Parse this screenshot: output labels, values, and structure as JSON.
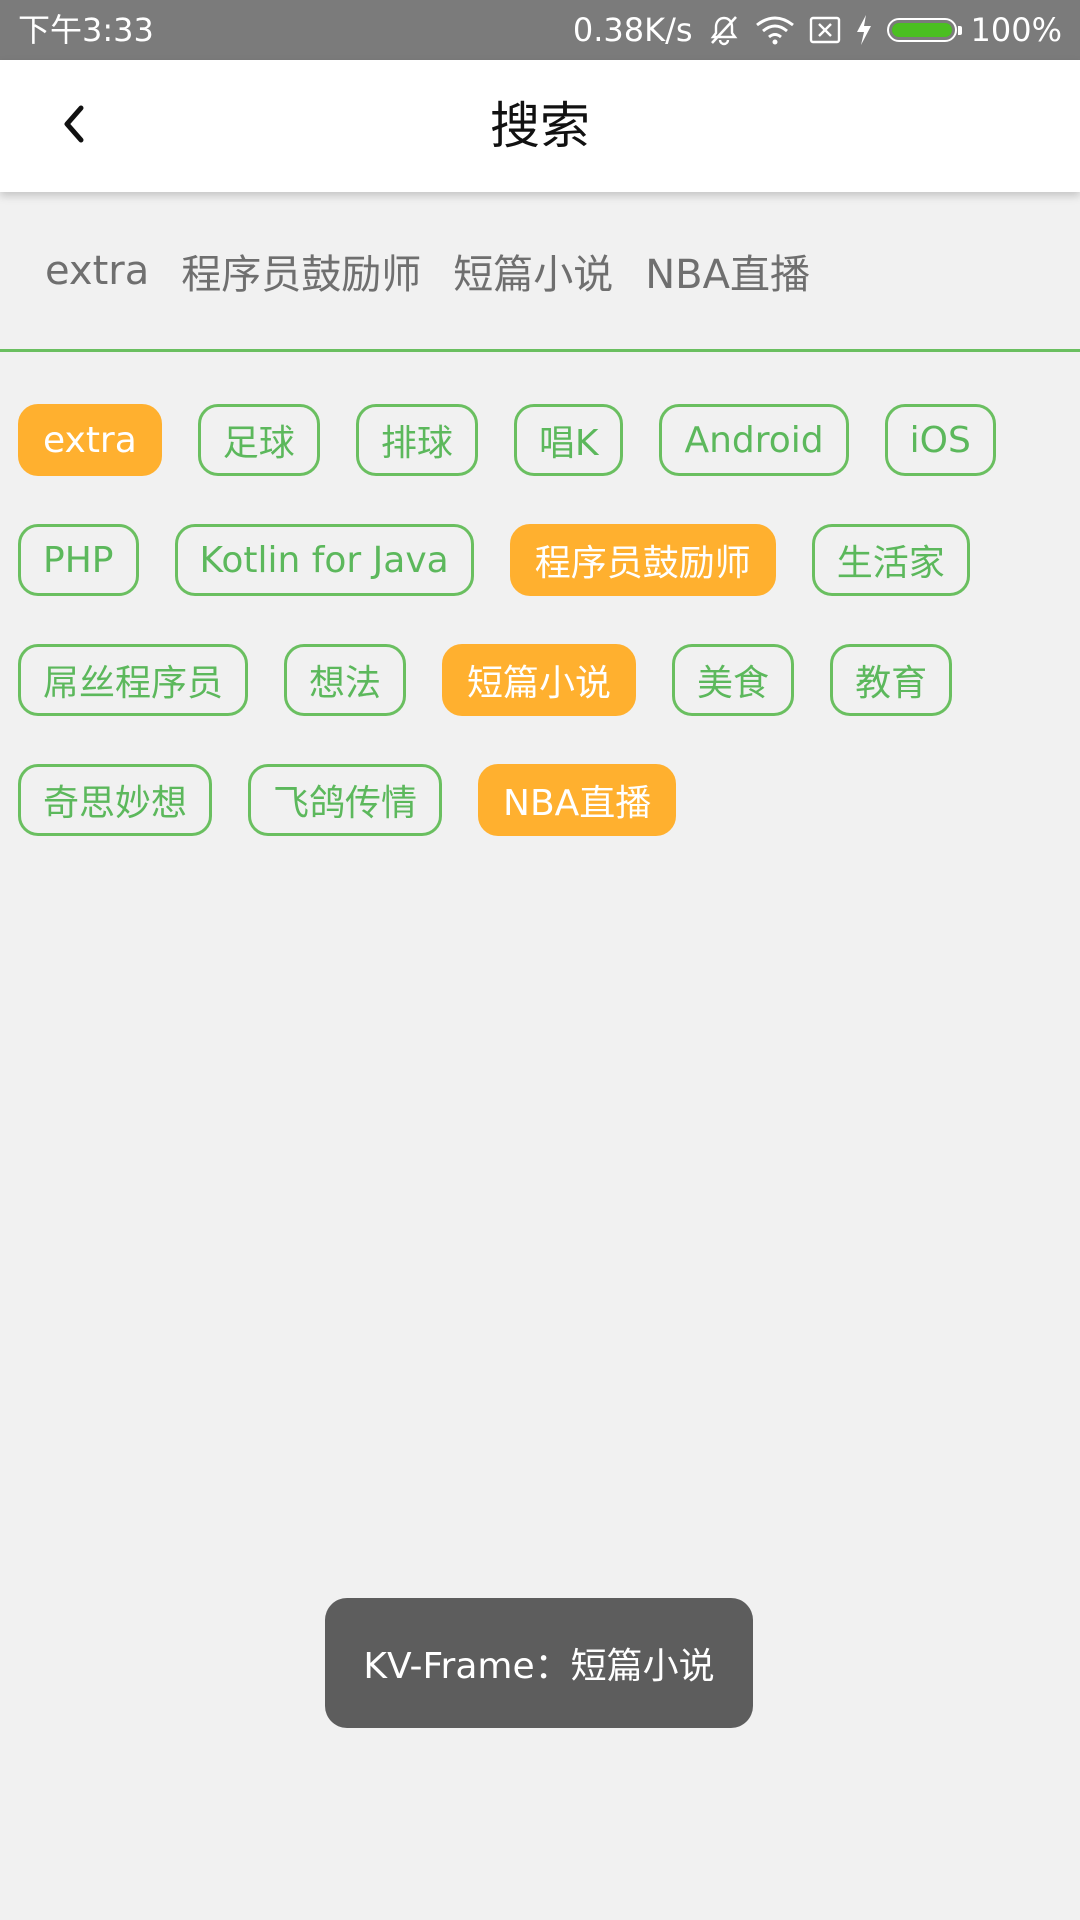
{
  "status_bar": {
    "time": "下午3:33",
    "net_speed": "0.38K/s",
    "battery_percent": "100%",
    "battery_level": 1.0,
    "battery_color": "#4bbf21",
    "icons": [
      "mute-bell-icon",
      "wifi-icon",
      "sim-x-icon",
      "charging-bolt-icon",
      "battery-icon"
    ]
  },
  "app_bar": {
    "back_icon": "back-arrow-icon",
    "title": "搜索"
  },
  "selected_tags": [
    "extra",
    "程序员鼓励师",
    "短篇小说",
    "NBA直播"
  ],
  "tags": [
    {
      "label": "extra",
      "selected": true
    },
    {
      "label": "足球",
      "selected": false
    },
    {
      "label": "排球",
      "selected": false
    },
    {
      "label": "唱K",
      "selected": false
    },
    {
      "label": "Android",
      "selected": false
    },
    {
      "label": "iOS",
      "selected": false
    },
    {
      "label": "PHP",
      "selected": false
    },
    {
      "label": "Kotlin for Java",
      "selected": false
    },
    {
      "label": "程序员鼓励师",
      "selected": true
    },
    {
      "label": "生活家",
      "selected": false
    },
    {
      "label": "屌丝程序员",
      "selected": false
    },
    {
      "label": "想法",
      "selected": false
    },
    {
      "label": "短篇小说",
      "selected": true
    },
    {
      "label": "美食",
      "selected": false
    },
    {
      "label": "教育",
      "selected": false
    },
    {
      "label": "奇思妙想",
      "selected": false
    },
    {
      "label": "飞鸽传情",
      "selected": false
    },
    {
      "label": "NBA直播",
      "selected": true
    }
  ],
  "toast": {
    "text": "KV-Frame：短篇小说"
  },
  "colors": {
    "accent_green": "#6abf60",
    "tag_text_green": "#5cb85c",
    "selected_orange": "#ffb02f",
    "background": "#f1f1f1",
    "status_bar": "#7b7b7b",
    "toast_bg": "#5d5d5d"
  }
}
